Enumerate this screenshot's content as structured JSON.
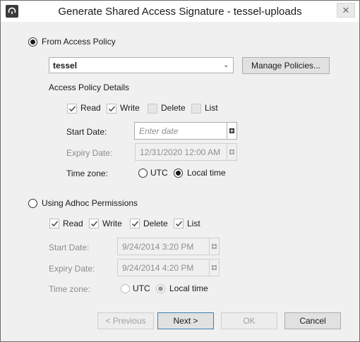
{
  "window": {
    "title": "Generate Shared Access Signature - tessel-uploads",
    "close_glyph": "✕"
  },
  "access_policy": {
    "option_label": "From Access Policy",
    "selected_policy": "tessel",
    "manage_button": "Manage Policies...",
    "details_heading": "Access Policy Details",
    "permissions": [
      {
        "label": "Read",
        "checked": true
      },
      {
        "label": "Write",
        "checked": true
      },
      {
        "label": "Delete",
        "checked": false
      },
      {
        "label": "List",
        "checked": false
      }
    ],
    "start_date_label": "Start Date:",
    "start_date_placeholder": "Enter date",
    "expiry_date_label": "Expiry Date:",
    "expiry_date_value": "12/31/2020 12:00 AM",
    "timezone_label": "Time zone:",
    "tz_utc": "UTC",
    "tz_local": "Local time"
  },
  "adhoc": {
    "option_label": "Using Adhoc Permissions",
    "permissions": [
      {
        "label": "Read",
        "checked": true
      },
      {
        "label": "Write",
        "checked": true
      },
      {
        "label": "Delete",
        "checked": true
      },
      {
        "label": "List",
        "checked": true
      }
    ],
    "start_date_label": "Start Date:",
    "start_date_value": "9/24/2014 3:20 PM",
    "expiry_date_label": "Expiry Date:",
    "expiry_date_value": "9/24/2014 4:20 PM",
    "timezone_label": "Time zone:",
    "tz_utc": "UTC",
    "tz_local": "Local time"
  },
  "footer": {
    "previous": "< Previous",
    "next": "Next >",
    "ok": "OK",
    "cancel": "Cancel"
  }
}
